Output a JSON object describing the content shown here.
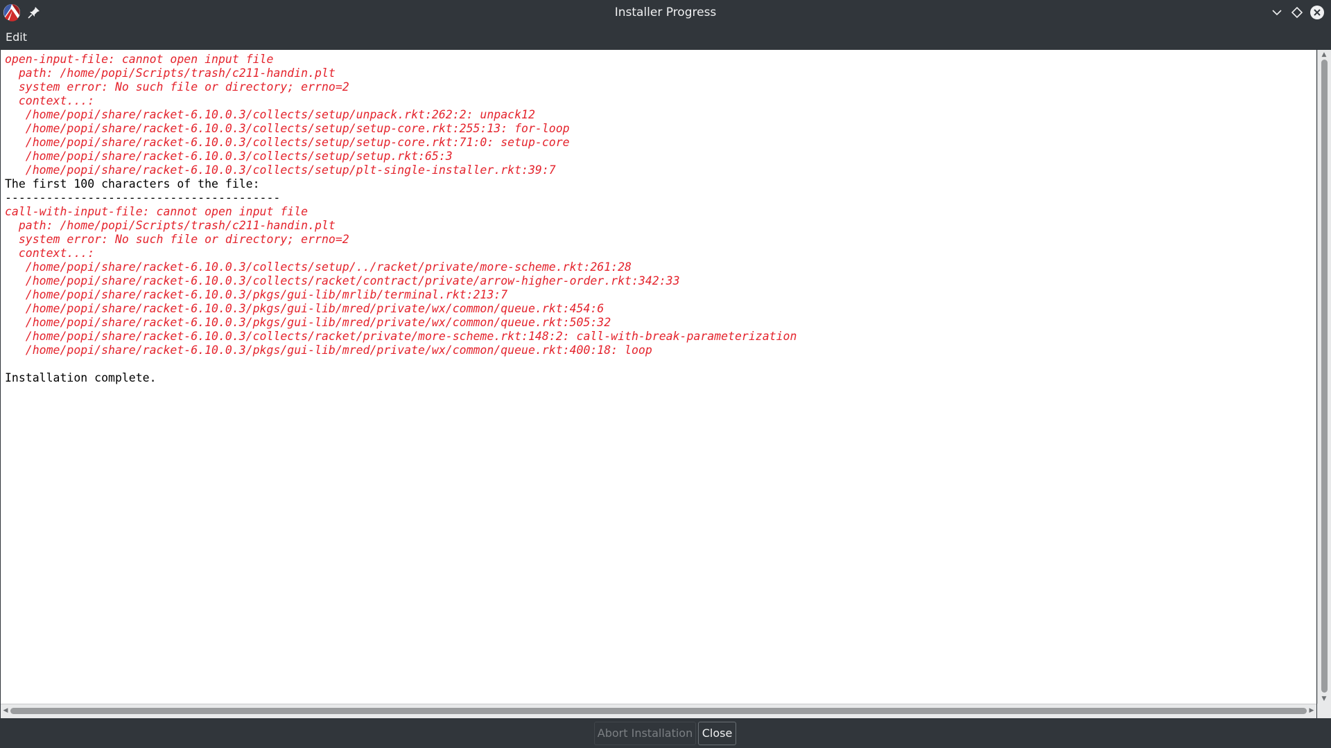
{
  "window": {
    "title": "Installer Progress",
    "app_icon": "racket-logo-icon",
    "pin_icon": "pin-icon",
    "controls": [
      "minimize-icon",
      "maximize-icon",
      "close-icon"
    ]
  },
  "menubar": {
    "items": [
      "Edit"
    ]
  },
  "log": {
    "lines": [
      {
        "text": "open-input-file: cannot open input file",
        "error": true
      },
      {
        "text": "  path: /home/popi/Scripts/trash/c211-handin.plt",
        "error": true
      },
      {
        "text": "  system error: No such file or directory; errno=2",
        "error": true
      },
      {
        "text": "  context...:",
        "error": true
      },
      {
        "text": "   /home/popi/share/racket-6.10.0.3/collects/setup/unpack.rkt:262:2: unpack12",
        "error": true
      },
      {
        "text": "   /home/popi/share/racket-6.10.0.3/collects/setup/setup-core.rkt:255:13: for-loop",
        "error": true
      },
      {
        "text": "   /home/popi/share/racket-6.10.0.3/collects/setup/setup-core.rkt:71:0: setup-core",
        "error": true
      },
      {
        "text": "   /home/popi/share/racket-6.10.0.3/collects/setup/setup.rkt:65:3",
        "error": true
      },
      {
        "text": "   /home/popi/share/racket-6.10.0.3/collects/setup/plt-single-installer.rkt:39:7",
        "error": true
      },
      {
        "text": "The first 100 characters of the file:",
        "error": false
      },
      {
        "text": "----------------------------------------",
        "error": false
      },
      {
        "text": "call-with-input-file: cannot open input file",
        "error": true
      },
      {
        "text": "  path: /home/popi/Scripts/trash/c211-handin.plt",
        "error": true
      },
      {
        "text": "  system error: No such file or directory; errno=2",
        "error": true
      },
      {
        "text": "  context...:",
        "error": true
      },
      {
        "text": "   /home/popi/share/racket-6.10.0.3/collects/setup/../racket/private/more-scheme.rkt:261:28",
        "error": true
      },
      {
        "text": "   /home/popi/share/racket-6.10.0.3/collects/racket/contract/private/arrow-higher-order.rkt:342:33",
        "error": true
      },
      {
        "text": "   /home/popi/share/racket-6.10.0.3/pkgs/gui-lib/mrlib/terminal.rkt:213:7",
        "error": true
      },
      {
        "text": "   /home/popi/share/racket-6.10.0.3/pkgs/gui-lib/mred/private/wx/common/queue.rkt:454:6",
        "error": true
      },
      {
        "text": "   /home/popi/share/racket-6.10.0.3/pkgs/gui-lib/mred/private/wx/common/queue.rkt:505:32",
        "error": true
      },
      {
        "text": "   /home/popi/share/racket-6.10.0.3/collects/racket/private/more-scheme.rkt:148:2: call-with-break-parameterization",
        "error": true
      },
      {
        "text": "   /home/popi/share/racket-6.10.0.3/pkgs/gui-lib/mred/private/wx/common/queue.rkt:400:18: loop",
        "error": true
      },
      {
        "text": "",
        "error": false
      },
      {
        "text": "Installation complete.",
        "error": false
      }
    ],
    "error_color": "#e4232c"
  },
  "buttons": {
    "abort_label": "Abort Installation",
    "abort_enabled": false,
    "close_label": "Close"
  }
}
